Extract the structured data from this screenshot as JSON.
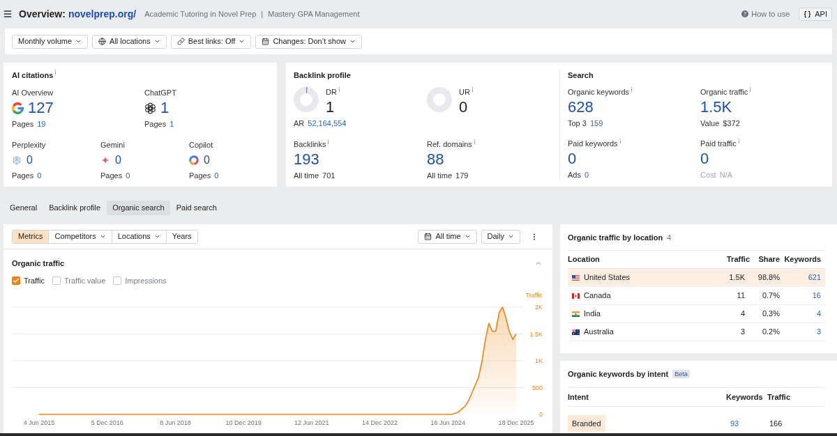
{
  "header": {
    "title": "Overview:",
    "domain": "novelprep.org/",
    "breadcrumbs": [
      "Academic Tutoring in Novel Prep",
      "|",
      "Mastery GPA Management"
    ],
    "help_link": "How to use",
    "api_button": "API"
  },
  "filters": [
    {
      "label": "Monthly volume"
    },
    {
      "label": "All locations"
    },
    {
      "label": "Best links: Off"
    },
    {
      "label": "Changes: Don’t show"
    }
  ],
  "ai_citations": {
    "title": "AI citations",
    "info": true,
    "primary": [
      {
        "name": "AI Overview",
        "value": "127",
        "pages_label": "Pages",
        "pages": "19"
      },
      {
        "name": "ChatGPT",
        "value": "1",
        "pages_label": "Pages",
        "pages": "1"
      }
    ],
    "secondary": [
      {
        "name": "Perplexity",
        "value": "0",
        "pages_label": "Pages",
        "pages": "0"
      },
      {
        "name": "Gemini",
        "value": "0",
        "pages_label": "Pages",
        "pages": "0"
      },
      {
        "name": "Copilot",
        "value": "0",
        "pages_label": "Pages",
        "pages": "0"
      }
    ]
  },
  "backlink_profile": {
    "title": "Backlink profile",
    "ratings": [
      {
        "label": "DR",
        "info": true,
        "value": "1",
        "sub_label": "AR",
        "sub_value": "52,164,554"
      },
      {
        "label": "UR",
        "info": true,
        "value": "0"
      }
    ],
    "stats": [
      {
        "label": "Backlinks",
        "info": true,
        "value": "193",
        "sub_label": "All time",
        "sub_value": "701",
        "kind": "plain"
      },
      {
        "label": "Ref. domains",
        "info": true,
        "value": "88",
        "sub_label": "All time",
        "sub_value": "179",
        "kind": "plain"
      }
    ]
  },
  "search": {
    "title": "Search",
    "metrics": [
      {
        "label": "Organic keywords",
        "info": true,
        "value": "628",
        "sub_label": "Top 3",
        "sub_value": "159",
        "kind": "link"
      },
      {
        "label": "Organic traffic",
        "info": true,
        "value": "1.5K",
        "sub_label": "Value",
        "sub_value": "$372",
        "kind": "plain"
      },
      {
        "label": "Paid keywords",
        "info": true,
        "value": "0",
        "sub_label": "Ads",
        "sub_value": "0",
        "kind": "link"
      },
      {
        "label": "Paid traffic",
        "info": true,
        "value": "0",
        "sub_label": "Cost",
        "sub_value": "N/A",
        "kind": "muted"
      }
    ]
  },
  "tabs": [
    {
      "label": "General",
      "selected": false
    },
    {
      "label": "Backlink profile",
      "selected": false
    },
    {
      "label": "Organic search",
      "selected": true
    },
    {
      "label": "Paid search",
      "selected": false
    }
  ],
  "traffic_panel": {
    "segments": [
      {
        "label": "Metrics",
        "selected": true,
        "dropdown": false
      },
      {
        "label": "Competitors",
        "selected": false,
        "dropdown": true
      },
      {
        "label": "Locations",
        "selected": false,
        "dropdown": true
      },
      {
        "label": "Years",
        "selected": false,
        "dropdown": false
      }
    ],
    "period": "All time",
    "interval": "Daily",
    "section_title": "Organic traffic",
    "expanded": true,
    "toggles": [
      {
        "label": "Traffic",
        "checked": true
      },
      {
        "label": "Traffic value",
        "checked": false
      },
      {
        "label": "Impressions",
        "checked": false
      }
    ],
    "chart_data": {
      "type": "area",
      "grid": true,
      "categories": [
        "4 Jun 2015",
        null,
        null,
        null,
        null,
        null,
        null,
        null,
        null,
        null,
        null,
        null,
        null,
        null,
        null,
        null,
        null,
        null,
        null,
        null,
        "5 Dec 2016",
        null,
        null,
        null,
        null,
        null,
        null,
        null,
        null,
        null,
        null,
        null,
        null,
        null,
        null,
        null,
        null,
        null,
        null,
        null,
        "8 Jun 2018",
        null,
        null,
        null,
        null,
        null,
        null,
        null,
        null,
        null,
        null,
        null,
        null,
        null,
        null,
        null,
        null,
        null,
        null,
        null,
        "10 Dec 2019",
        null,
        null,
        null,
        null,
        null,
        null,
        null,
        null,
        null,
        null,
        null,
        null,
        null,
        null,
        null,
        null,
        null,
        null,
        null,
        "12 Jun 2021",
        null,
        null,
        null,
        null,
        null,
        null,
        null,
        null,
        null,
        null,
        null,
        null,
        null,
        null,
        null,
        null,
        null,
        null,
        null,
        "14 Dec 2022",
        null,
        null,
        null,
        null,
        null,
        null,
        null,
        null,
        null,
        null,
        null,
        null,
        null,
        null,
        null,
        null,
        null,
        null,
        null,
        "16 Jun 2024",
        null,
        null,
        null,
        null,
        null,
        null,
        null,
        null,
        null,
        null,
        null,
        null,
        null,
        null,
        null,
        null,
        null,
        null,
        null,
        "18 Dec 2025"
      ],
      "series": [
        {
          "name": "Traffic",
          "color": "#f5820d",
          "values": [
            0,
            0,
            0,
            0,
            0,
            0,
            0,
            0,
            0,
            0,
            0,
            0,
            0,
            0,
            0,
            0,
            0,
            0,
            0,
            0,
            0,
            0,
            0,
            0,
            0,
            0,
            0,
            0,
            0,
            0,
            0,
            0,
            0,
            0,
            0,
            0,
            0,
            0,
            0,
            0,
            0,
            0,
            0,
            0,
            0,
            0,
            0,
            0,
            0,
            0,
            0,
            0,
            0,
            0,
            0,
            0,
            0,
            0,
            0,
            0,
            0,
            0,
            0,
            0,
            0,
            0,
            0,
            0,
            0,
            0,
            0,
            0,
            0,
            0,
            0,
            0,
            0,
            0,
            0,
            0,
            0,
            0,
            0,
            0,
            0,
            0,
            0,
            0,
            0,
            0,
            0,
            0,
            0,
            0,
            0,
            0,
            0,
            0,
            0,
            0,
            0,
            0,
            0,
            0,
            0,
            0,
            0,
            0,
            0,
            0,
            0,
            0,
            0,
            0,
            0,
            0,
            0,
            0,
            0,
            0,
            0,
            0,
            20,
            40,
            100,
            150,
            250,
            400,
            550,
            700,
            1000,
            1400,
            1700,
            1550,
            1550,
            1900,
            2000,
            1800,
            1550,
            1400,
            1500
          ]
        }
      ],
      "ylim": [
        0,
        2000
      ],
      "yticks": [
        0,
        500,
        {
          "value": 1000,
          "label": "1K"
        },
        {
          "value": 1500,
          "label": "1.5K"
        },
        {
          "value": 2000,
          "label": "2K"
        }
      ]
    }
  },
  "location_table": {
    "title": "Organic traffic by location",
    "count": "4",
    "columns": [
      "Location",
      "Traffic",
      "Share",
      "Keywords"
    ],
    "rows": [
      {
        "location": "United States",
        "traffic": "1.5K",
        "share": "98.8%",
        "keywords": "621",
        "selected": true
      },
      {
        "location": "Canada",
        "traffic": "11",
        "share": "0.7%",
        "keywords": "16",
        "selected": false
      },
      {
        "location": "India",
        "traffic": "4",
        "share": "0.3%",
        "keywords": "4",
        "selected": false
      },
      {
        "location": "Australia",
        "traffic": "3",
        "share": "0.2%",
        "keywords": "3",
        "selected": false
      }
    ]
  },
  "intent_table": {
    "title": "Organic keywords by intent",
    "badge": "Beta",
    "columns": [
      "Intent",
      "Keywords",
      "Traffic"
    ],
    "rows": [
      {
        "intent": "Branded",
        "keywords": "93",
        "traffic": "166",
        "selected": true
      }
    ]
  }
}
